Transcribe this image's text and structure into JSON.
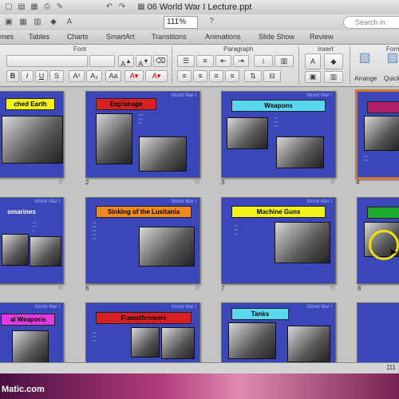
{
  "window": {
    "title": "06 World War I Lecture.ppt"
  },
  "toolbar": {
    "zoom": "111%",
    "search_placeholder": "Search in"
  },
  "ribbon_tabs": [
    "mes",
    "Tables",
    "Charts",
    "SmartArt",
    "Transitions",
    "Animations",
    "Slide Show",
    "Review"
  ],
  "ribbon_groups": {
    "font": "Font",
    "paragraph": "Paragraph",
    "insert": "Insert",
    "format": "Form"
  },
  "ribbon_buttons": {
    "arrange": "Arrange",
    "quick": "Quick"
  },
  "slides": [
    {
      "number": "",
      "title": "ched Earth",
      "header": "World War I",
      "title_color": "#f2f21a"
    },
    {
      "number": "2",
      "title": "Espionage",
      "header": "World War I",
      "title_color": "#d92020"
    },
    {
      "number": "3",
      "title": "Weapons",
      "header": "World War I",
      "title_color": "#5ad8f0"
    },
    {
      "number": "4",
      "title": "",
      "header": "",
      "title_color": "#b01f6a"
    },
    {
      "number": "",
      "title": "omarines",
      "header": "World War I",
      "title_color": "#3b46b8"
    },
    {
      "number": "6",
      "title": "Sinking of the Lusitania",
      "header": "World War I",
      "title_color": "#f08a20"
    },
    {
      "number": "7",
      "title": "Machine Guns",
      "header": "World War I",
      "title_color": "#f2f21a"
    },
    {
      "number": "8",
      "title": "",
      "header": "",
      "title_color": "#1faa2a"
    },
    {
      "number": "",
      "title": "al Weapons",
      "header": "World War I",
      "title_color": "#e33ae0"
    },
    {
      "number": "",
      "title": "Flamethrowers",
      "header": "World War I",
      "title_color": "#d92020"
    },
    {
      "number": "",
      "title": "Tanks",
      "header": "World War I",
      "title_color": "#5ad8f0"
    },
    {
      "number": "",
      "title": "",
      "header": "",
      "title_color": "#3b46b8"
    }
  ],
  "status": {
    "zoom": "111"
  },
  "watermark": {
    "brand": "Matic.com"
  }
}
